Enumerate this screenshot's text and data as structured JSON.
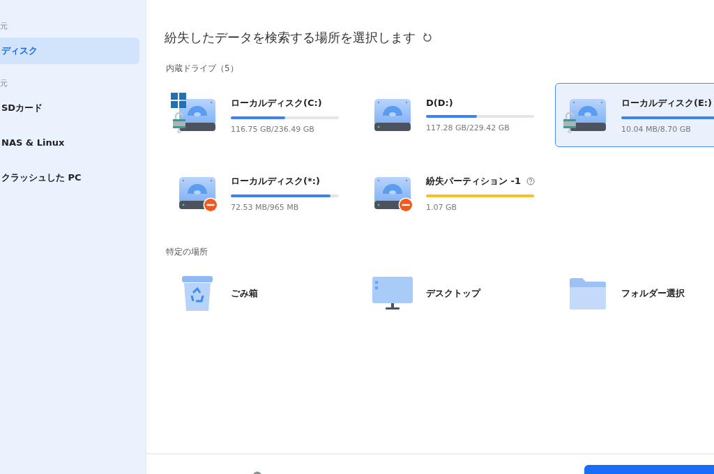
{
  "sidebar": {
    "sections": [
      {
        "label": "元",
        "items": [
          {
            "label": "ディスク",
            "selected": true
          }
        ]
      },
      {
        "label": "元",
        "items": [
          {
            "label": "SDカード",
            "selected": false
          },
          {
            "label": "NAS & Linux",
            "selected": false
          },
          {
            "label": "クラッシュした PC",
            "selected": false
          }
        ]
      }
    ]
  },
  "main": {
    "title": "紛失したデータを検索する場所を選択します",
    "drives_heading": "内蔵ドライブ（5）",
    "drives": [
      {
        "name": "ローカルディスク(C:)",
        "usage": "116.75 GB/236.49 GB",
        "level": 0.5,
        "color": "#3b82f6",
        "windows": true,
        "locked": true,
        "unavailable": false,
        "help": false,
        "selected": false
      },
      {
        "name": "D(D:)",
        "usage": "117.28 GB/229.42 GB",
        "level": 0.47,
        "color": "#3b82f6",
        "windows": false,
        "locked": false,
        "unavailable": false,
        "help": false,
        "selected": false
      },
      {
        "name": "ローカルディスク(E:)",
        "usage": "10.04 MB/8.70 GB",
        "level": 1,
        "color": "#3b82f6",
        "windows": false,
        "locked": true,
        "unavailable": false,
        "help": false,
        "selected": true
      },
      {
        "name": "ローカルディスク(*:)",
        "usage": "72.53 MB/965 MB",
        "level": 0.92,
        "color": "#3b82f6",
        "windows": false,
        "locked": false,
        "unavailable": true,
        "help": false,
        "selected": false
      },
      {
        "name": "紛失パーティション -1",
        "usage": "1.07 GB",
        "level": 1,
        "color": "#fbbf24",
        "windows": false,
        "locked": false,
        "unavailable": true,
        "help": true,
        "selected": false
      }
    ],
    "locations_heading": "特定の場所",
    "locations": [
      {
        "kind": "trash",
        "name": "ごみ箱"
      },
      {
        "kind": "desktop",
        "name": "デスクトップ"
      },
      {
        "kind": "folder",
        "name": "フォルダー選択"
      }
    ]
  }
}
